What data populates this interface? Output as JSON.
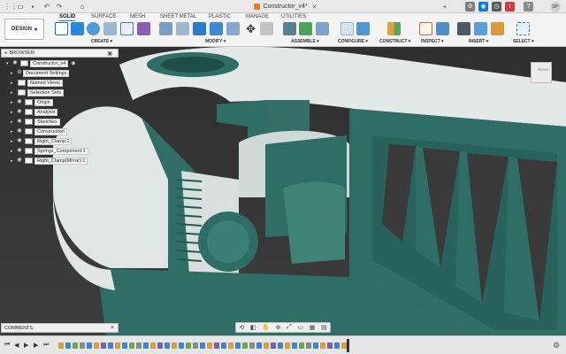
{
  "window": {
    "title": "Constructor_v4*",
    "user_initials": "DP"
  },
  "ribbon": {
    "workspace_label": "DESIGN",
    "tabs": [
      "SOLID",
      "SURFACE",
      "MESH",
      "SHEET METAL",
      "PLASTIC",
      "MANAGE",
      "UTILITIES"
    ],
    "groups": [
      "CREATE ▾",
      "MODIFY ▾",
      "ASSEMBLE ▾",
      "CONFIGURE ▾",
      "CONSTRUCT ▾",
      "INSPECT ▾",
      "INSERT ▾",
      "SELECT ▾"
    ]
  },
  "browser": {
    "header": "BROWSER",
    "root": "Constructor_v4",
    "items": [
      "Document Settings",
      "Named Views",
      "Selection Sets",
      "Origin",
      "Analysis",
      "Sketches",
      "Construction",
      "Right_Clamp:1",
      "Springs_Component:1",
      "Right_Clamp(Mirror):1"
    ]
  },
  "viewcube_label": "RIGHT",
  "comments": {
    "label": "COMMENTS",
    "add": "+"
  },
  "colors": {
    "body": "#2e6e66",
    "body_light": "#e2e8e6",
    "accent": "#0696d7",
    "viewport": "#383838"
  },
  "icons": [
    "grid-icon",
    "save-icon",
    "undo-icon",
    "redo-icon",
    "home-icon",
    "gear-icon",
    "orbit-icon",
    "pan-icon",
    "zoom-icon",
    "display-icon"
  ]
}
